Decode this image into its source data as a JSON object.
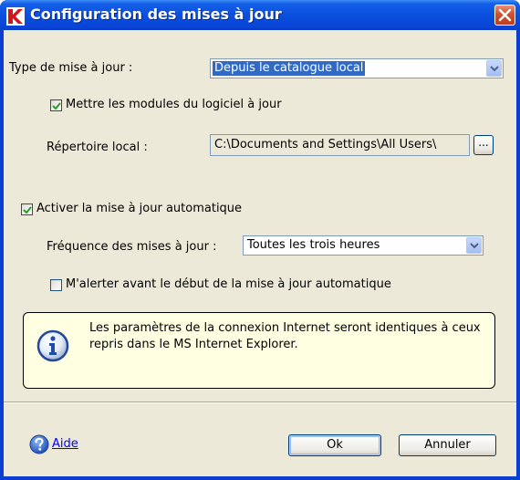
{
  "window": {
    "title": "Configuration des mises à jour"
  },
  "update_type": {
    "label": "Type de mise à jour :",
    "selected": "Depuis le catalogue local"
  },
  "update_modules": {
    "label": "Mettre les modules du logiciel à jour",
    "checked": true
  },
  "local_dir": {
    "label": "Répertoire local :",
    "value": "C:\\Documents and Settings\\All Users\\",
    "browse_label": "..."
  },
  "auto_update": {
    "label": "Activer la mise à jour automatique",
    "checked": true
  },
  "frequency": {
    "label": "Fréquence des mises à jour :",
    "selected": "Toutes les trois heures"
  },
  "alert_before": {
    "label": "M'alerter avant le début de la mise à jour automatique",
    "checked": false
  },
  "info": {
    "text": "Les paramètres de la connexion Internet seront identiques à ceux repris dans le MS Internet Explorer."
  },
  "footer": {
    "help_label": "Aide",
    "ok_label": "Ok",
    "cancel_label": "Annuler"
  },
  "colors": {
    "titlebar": "#0a4fde",
    "client": "#ece9d8",
    "info_bg": "#ffffe1",
    "selection": "#316ac5"
  },
  "icons": [
    "kaspersky-k-icon",
    "close-icon",
    "checkmark-icon",
    "dropdown-arrow-icon",
    "info-icon",
    "help-icon"
  ]
}
